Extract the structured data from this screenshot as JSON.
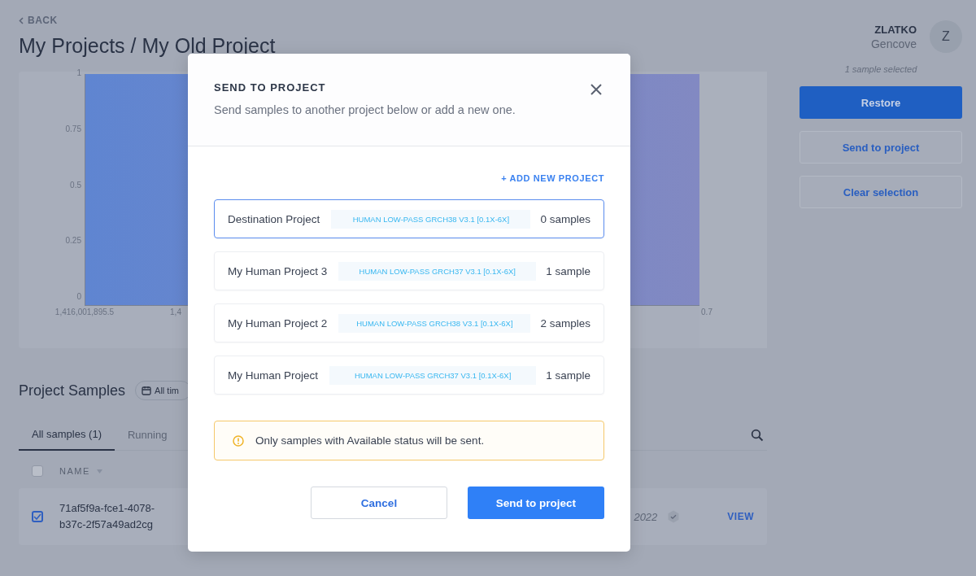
{
  "header": {
    "back_link": "BACK",
    "title": "My Projects / My Old Project",
    "user": {
      "name": "ZLATKO",
      "org": "Gencove",
      "avatar_initial": "Z"
    }
  },
  "chart": {
    "y_ticks": [
      "1",
      "0.75",
      "0.5",
      "0.25",
      "0"
    ],
    "x_ticks": [
      "1,416,001,895.5",
      "1,4",
      "0.7"
    ]
  },
  "sidebar": {
    "selection_note": "1 sample selected",
    "buttons": [
      {
        "label": "Restore",
        "kind": "primary"
      },
      {
        "label": "Send to project",
        "kind": "outline"
      },
      {
        "label": "Clear selection",
        "kind": "outline"
      }
    ]
  },
  "samples": {
    "title": "Project Samples",
    "date_filter": "All tim",
    "tabs": [
      {
        "label": "All samples (1)",
        "selected": true
      },
      {
        "label": "Running",
        "selected": false
      }
    ],
    "header": {
      "checked": false,
      "name_column": "NAME"
    },
    "rows": [
      {
        "checked": true,
        "name": "71af5f9a-fce1-4078-b37c-2f57a49ad2cg",
        "date": "2022",
        "action": "VIEW"
      }
    ]
  },
  "dialog": {
    "title": "SEND TO PROJECT",
    "subtitle": "Send samples to another project below or add a new one.",
    "add_link": "+ ADD NEW PROJECT",
    "projects": [
      {
        "name": "Destination Project",
        "tag": "HUMAN LOW-PASS GRCH38 V3.1 [0.1X-6X]",
        "count": "0 samples",
        "selected": true
      },
      {
        "name": "My Human Project 3",
        "tag": "HUMAN LOW-PASS GRCH37 V3.1 [0.1X-6X]",
        "count": "1 sample",
        "selected": false
      },
      {
        "name": "My Human Project 2",
        "tag": "HUMAN LOW-PASS GRCH38 V3.1 [0.1X-6X]",
        "count": "2 samples",
        "selected": false
      },
      {
        "name": "My Human Project",
        "tag": "HUMAN LOW-PASS GRCH37 V3.1 [0.1X-6X]",
        "count": "1 sample",
        "selected": false
      }
    ],
    "warning": "Only samples with Available status will be sent.",
    "buttons": [
      {
        "label": "Cancel",
        "kind": "secondary"
      },
      {
        "label": "Send to project",
        "kind": "primary"
      }
    ]
  }
}
